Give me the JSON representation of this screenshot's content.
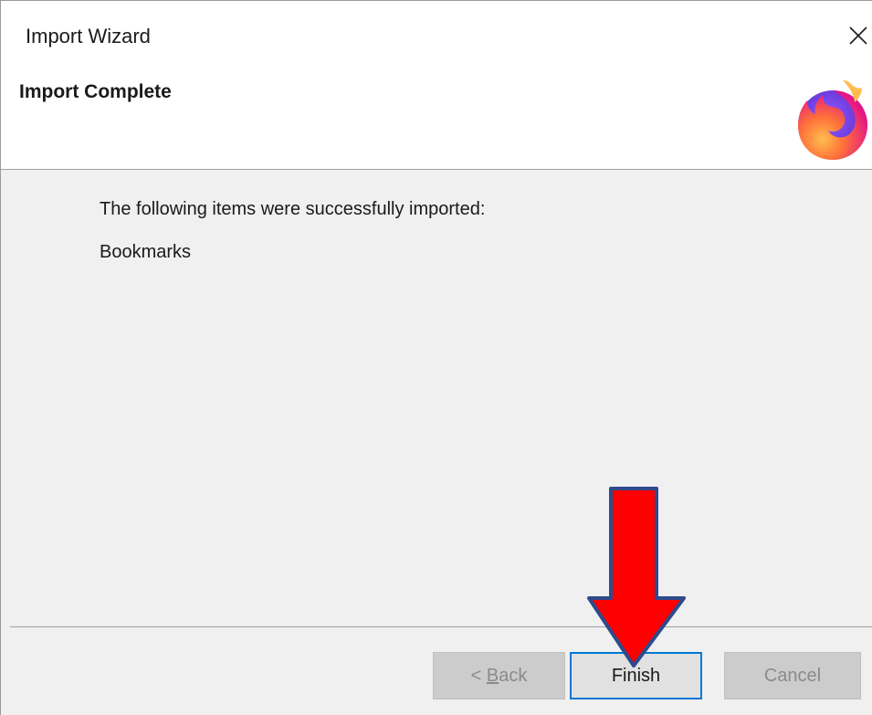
{
  "window": {
    "title": "Import Wizard",
    "close_icon": "close-icon"
  },
  "header": {
    "title": "Import Complete",
    "logo_icon": "firefox-logo-icon"
  },
  "content": {
    "message": "The following items were successfully imported:",
    "items": [
      "Bookmarks"
    ]
  },
  "buttons": {
    "back_prefix": "< ",
    "back_mnemonic": "B",
    "back_rest": "ack",
    "finish_label": "Finish",
    "cancel_label": "Cancel"
  },
  "annotation": {
    "arrow_icon": "down-arrow-icon",
    "arrow_color": "#ff0000",
    "arrow_outline": "#2e4a8c"
  },
  "colors": {
    "focus_border": "#0078d7",
    "disabled_text": "#8a8a8a",
    "window_bg": "#f0f0f0"
  }
}
